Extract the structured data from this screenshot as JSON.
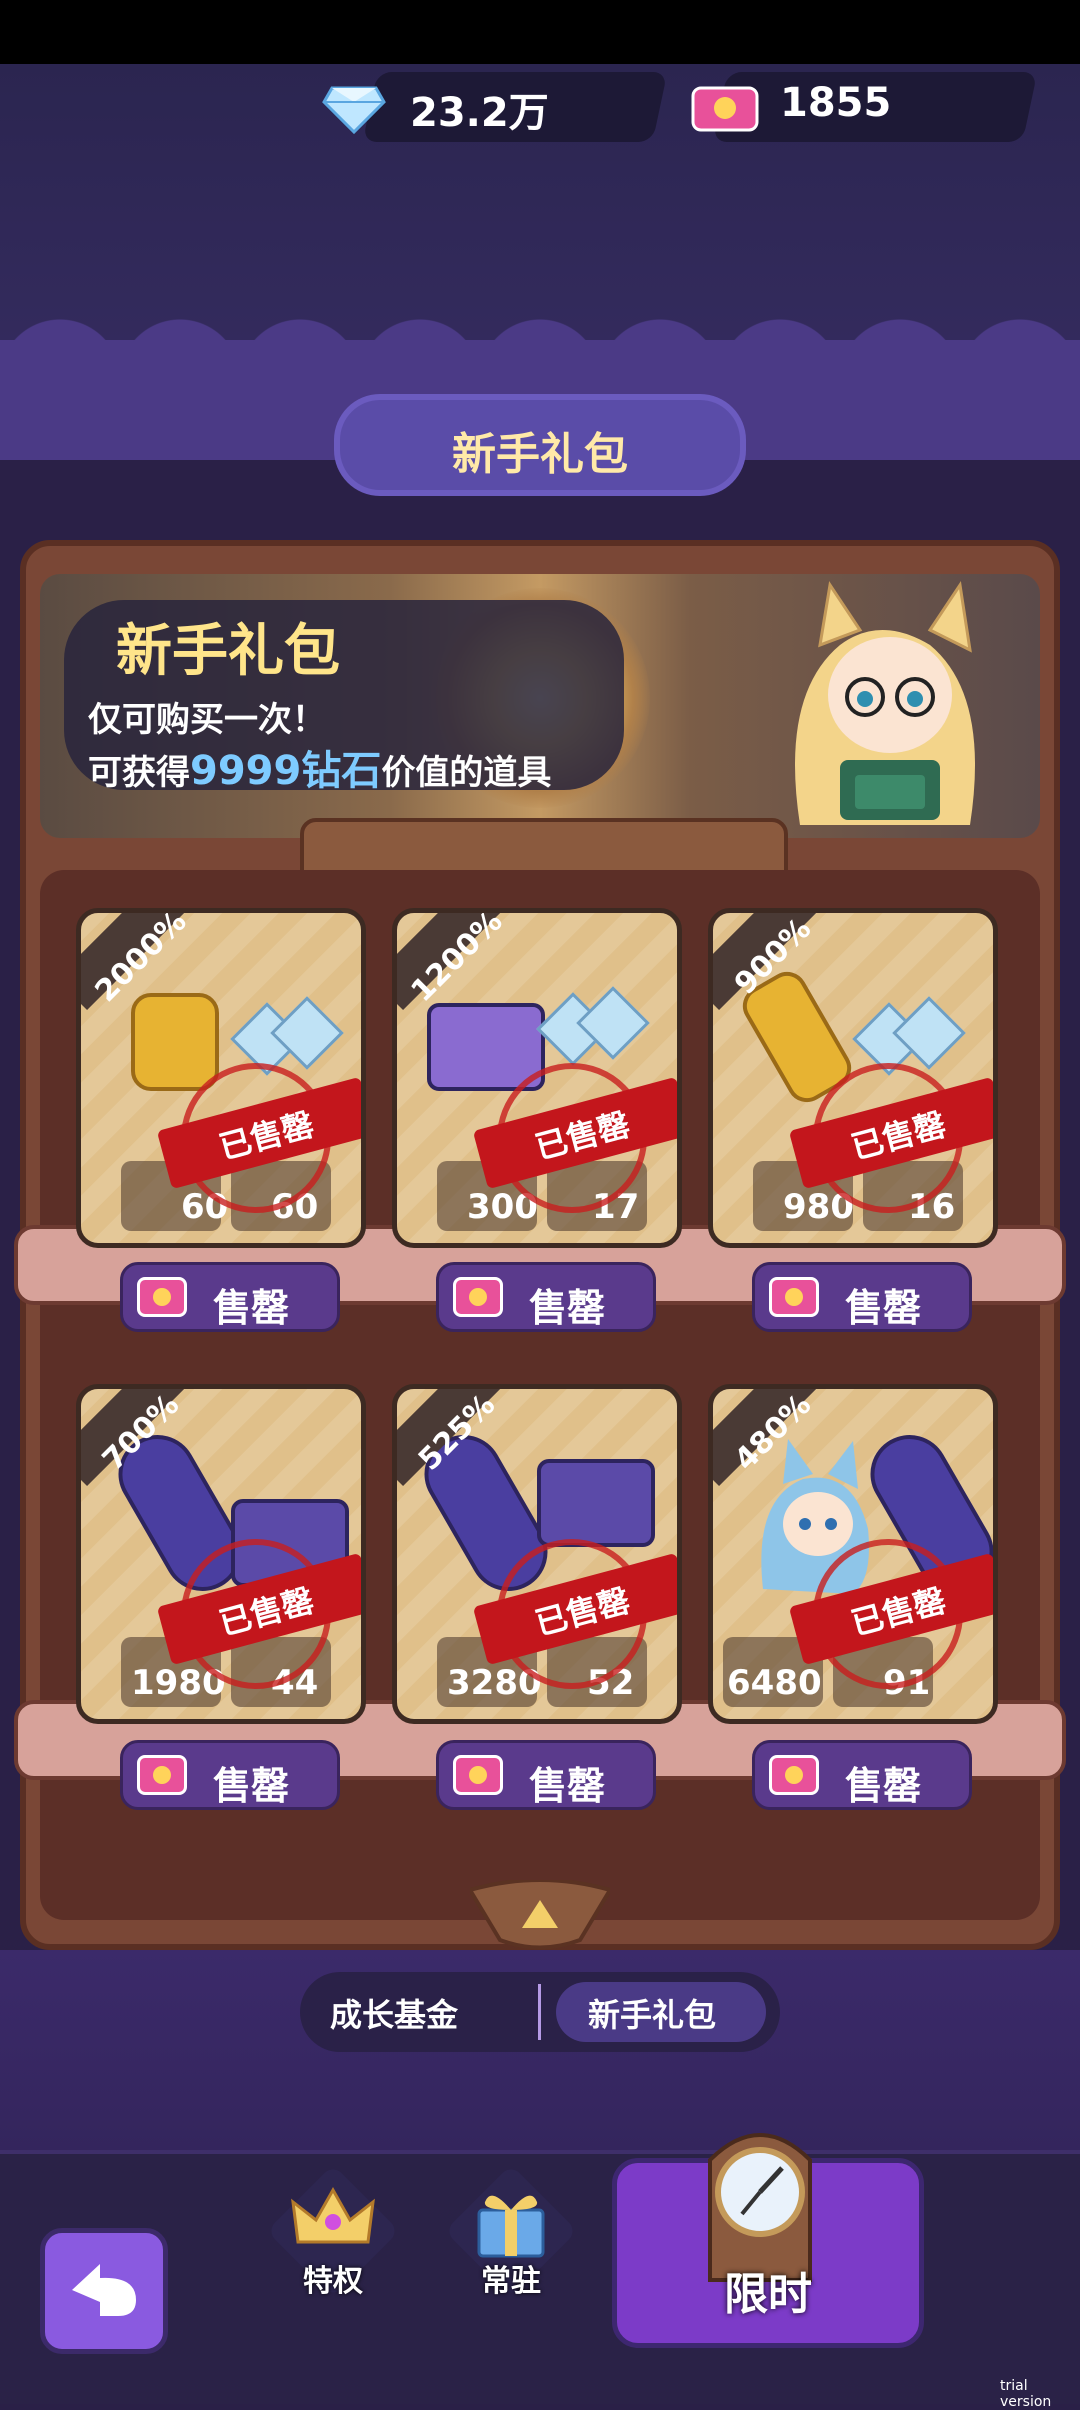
{
  "currency": {
    "diamonds": "23.2万",
    "tickets": "1855"
  },
  "page_title": "新手礼包",
  "banner": {
    "title": "新手礼包",
    "line1": "仅可购买一次！",
    "line2_prefix": "可获得",
    "line2_highlight": "9999钻石",
    "line2_suffix": "价值的道具"
  },
  "items": [
    {
      "percent": "2000%",
      "qty_left": "60",
      "qty_right": "60",
      "status": "已售罄",
      "price_label": "售罄"
    },
    {
      "percent": "1200%",
      "qty_left": "300",
      "qty_right": "17",
      "status": "已售罄",
      "price_label": "售罄"
    },
    {
      "percent": "900%",
      "qty_left": "980",
      "qty_right": "16",
      "status": "已售罄",
      "price_label": "售罄"
    },
    {
      "percent": "700%",
      "qty_left": "1980",
      "qty_right": "44",
      "status": "已售罄",
      "price_label": "售罄"
    },
    {
      "percent": "525%",
      "qty_left": "3280",
      "qty_right": "52",
      "status": "已售罄",
      "price_label": "售罄"
    },
    {
      "percent": "480%",
      "qty_left": "6480",
      "qty_right": "91",
      "status": "已售罄",
      "price_label": "售罄"
    }
  ],
  "subtabs": {
    "growth_fund": "成长基金",
    "newbie_pack": "新手礼包"
  },
  "nav": {
    "privilege": "特权",
    "permanent": "常驻",
    "limited": "限时"
  },
  "watermark": "trial version",
  "colors": {
    "sold_red": "#c3161c",
    "diamond_blue": "#7ecbff",
    "title_gold": "#ffe9a8"
  }
}
